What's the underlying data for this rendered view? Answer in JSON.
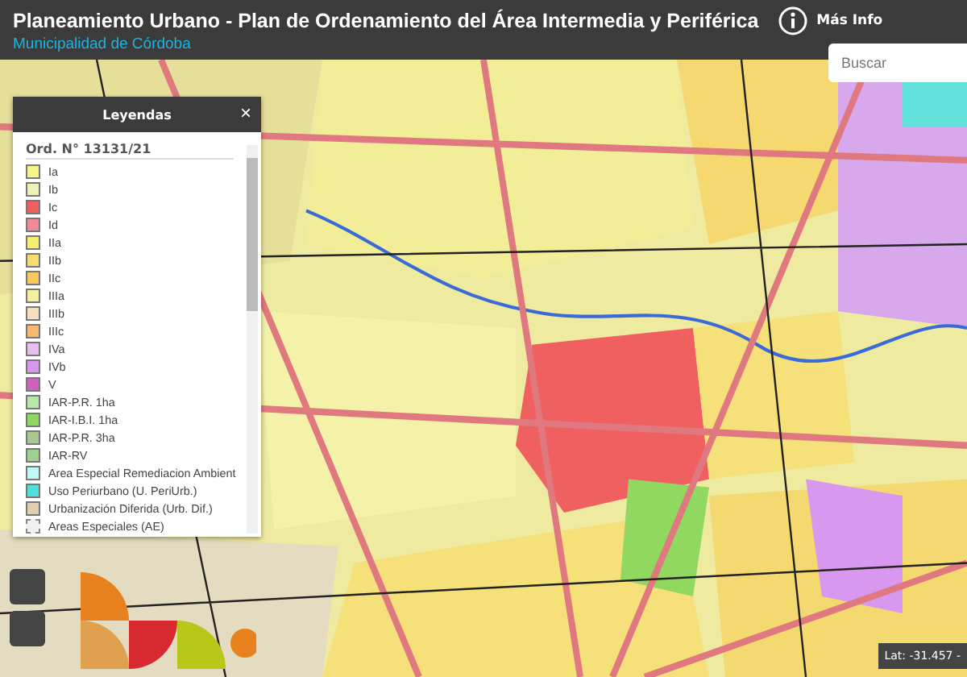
{
  "header": {
    "title": "Planeamiento Urbano - Plan de Ordenamiento del Área Intermedia y Periférica",
    "info_label": "Más Info",
    "subtitle": "Municipalidad de Córdoba"
  },
  "search": {
    "placeholder": "Buscar"
  },
  "legend": {
    "title": "Leyendas",
    "close": "×",
    "heading": "Ord. N° 13131/21",
    "items": [
      {
        "label": "Ia",
        "color": "#f5f58a",
        "kind": "solid"
      },
      {
        "label": "Ib",
        "color": "#eef2b8",
        "kind": "solid"
      },
      {
        "label": "Ic",
        "color": "#f06060",
        "kind": "solid"
      },
      {
        "label": "Id",
        "color": "#f08a96",
        "kind": "solid"
      },
      {
        "label": "IIa",
        "color": "#f5ef6e",
        "kind": "solid"
      },
      {
        "label": "IIb",
        "color": "#f5dc70",
        "kind": "solid"
      },
      {
        "label": "IIc",
        "color": "#f9c860",
        "kind": "solid"
      },
      {
        "label": "IIIa",
        "color": "#f5f0a0",
        "kind": "solid"
      },
      {
        "label": "IIIb",
        "color": "#f5dfc0",
        "kind": "solid"
      },
      {
        "label": "IIIc",
        "color": "#f7b870",
        "kind": "solid"
      },
      {
        "label": "IVa",
        "color": "#e8c0f0",
        "kind": "solid"
      },
      {
        "label": "IVb",
        "color": "#d898f0",
        "kind": "solid"
      },
      {
        "label": "V",
        "color": "#d060c0",
        "kind": "solid"
      },
      {
        "label": "IAR-P.R. 1ha",
        "color": "#b8e8a8",
        "kind": "solid"
      },
      {
        "label": "IAR-I.B.I. 1ha",
        "color": "#90d860",
        "kind": "solid"
      },
      {
        "label": "IAR-P.R. 3ha",
        "color": "#a8c890",
        "kind": "solid"
      },
      {
        "label": "IAR-RV",
        "color": "#a0d090",
        "kind": "solid"
      },
      {
        "label": "Area Especial Remediacion Ambient",
        "color": "#c0f8f8",
        "kind": "solid"
      },
      {
        "label": "Uso Periurbano (U. PeriUrb.)",
        "color": "#50e0d8",
        "kind": "solid"
      },
      {
        "label": "Urbanización Diferida (Urb. Dif.)",
        "color": "#e0d0b0",
        "kind": "solid"
      },
      {
        "label": "Areas Especiales (AE)",
        "color": "#f0f0f0",
        "kind": "dashed"
      }
    ]
  },
  "coordinates": "Lat: -31.457 -"
}
